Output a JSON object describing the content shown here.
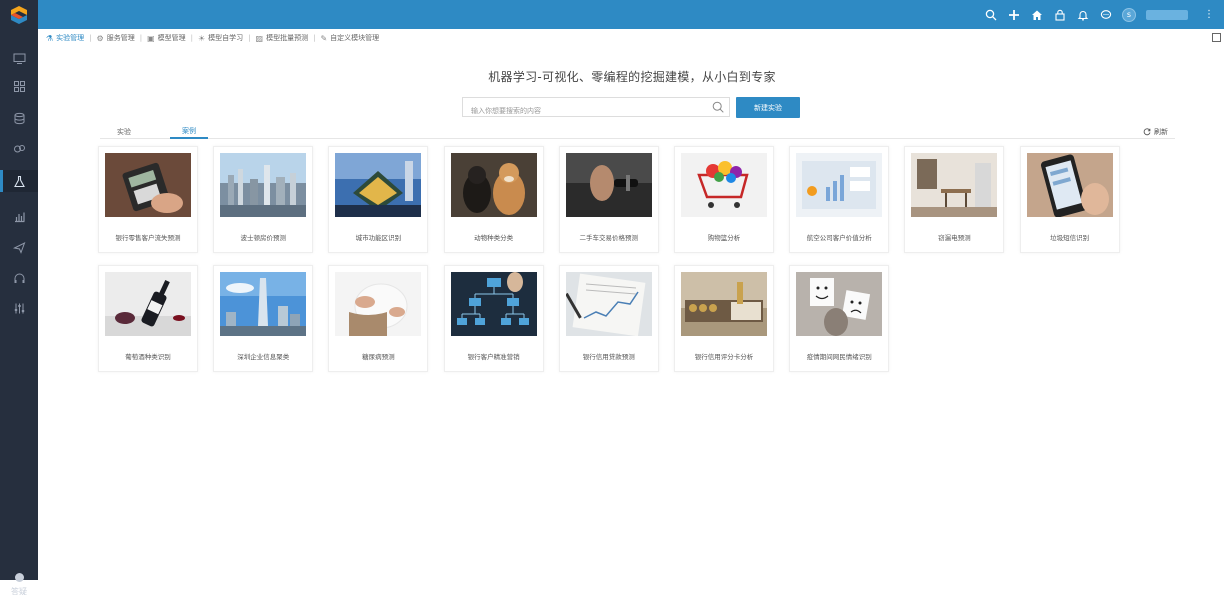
{
  "topbar": {
    "icons": [
      "search-icon",
      "plus-icon",
      "home-icon",
      "lock-icon",
      "bell-icon",
      "chat-icon"
    ],
    "avatar_letter": "s"
  },
  "sidebar": {
    "items": [
      "monitor-icon",
      "apps-icon",
      "database-icon",
      "gear-cubes-icon",
      "flask-icon",
      "bar-chart-icon",
      "paper-plane-icon",
      "headset-icon",
      "sliders-icon"
    ],
    "help_label": "答疑"
  },
  "breadcrumb": [
    {
      "icon": "flask-icon",
      "label": "实验管理"
    },
    {
      "icon": "gear-icon",
      "label": "服务管理"
    },
    {
      "icon": "cube-icon",
      "label": "模型管理"
    },
    {
      "icon": "bulb-icon",
      "label": "模型自学习"
    },
    {
      "icon": "image-icon",
      "label": "模型批量预测"
    },
    {
      "icon": "edit-icon",
      "label": "自定义模块管理"
    }
  ],
  "main": {
    "headline": "机器学习-可视化、零编程的挖掘建模，从小白到专家",
    "search_placeholder": "输入你想要搜索的内容",
    "new_button": "新建实验",
    "tabs": [
      "实验",
      "案例"
    ],
    "active_tab": 1,
    "refresh_label": "刷新"
  },
  "cases": [
    {
      "label": "银行零售客户流失预测",
      "thumb": "pos"
    },
    {
      "label": "波士顿房价预测",
      "thumb": "city"
    },
    {
      "label": "城市功能区识别",
      "thumb": "building"
    },
    {
      "label": "动物种类分类",
      "thumb": "dogs"
    },
    {
      "label": "二手车交易价格预测",
      "thumb": "key"
    },
    {
      "label": "购物篮分析",
      "thumb": "cart"
    },
    {
      "label": "航空公司客户价值分析",
      "thumb": "chart"
    },
    {
      "label": "窃漏电预测",
      "thumb": "room"
    },
    {
      "label": "垃圾短信识别",
      "thumb": "phone"
    },
    {
      "label": "葡萄酒种类识别",
      "thumb": "wine"
    },
    {
      "label": "深圳企业信息聚类",
      "thumb": "tower"
    },
    {
      "label": "糖尿病预测",
      "thumb": "belly"
    },
    {
      "label": "银行客户精准营销",
      "thumb": "network"
    },
    {
      "label": "银行信用贷款预测",
      "thumb": "paper"
    },
    {
      "label": "银行信用评分卡分析",
      "thumb": "coins"
    },
    {
      "label": "疫情期间网民情绪识别",
      "thumb": "faces"
    }
  ],
  "colors": {
    "accent": "#2e8ac4",
    "sidebar": "#262f3e"
  }
}
